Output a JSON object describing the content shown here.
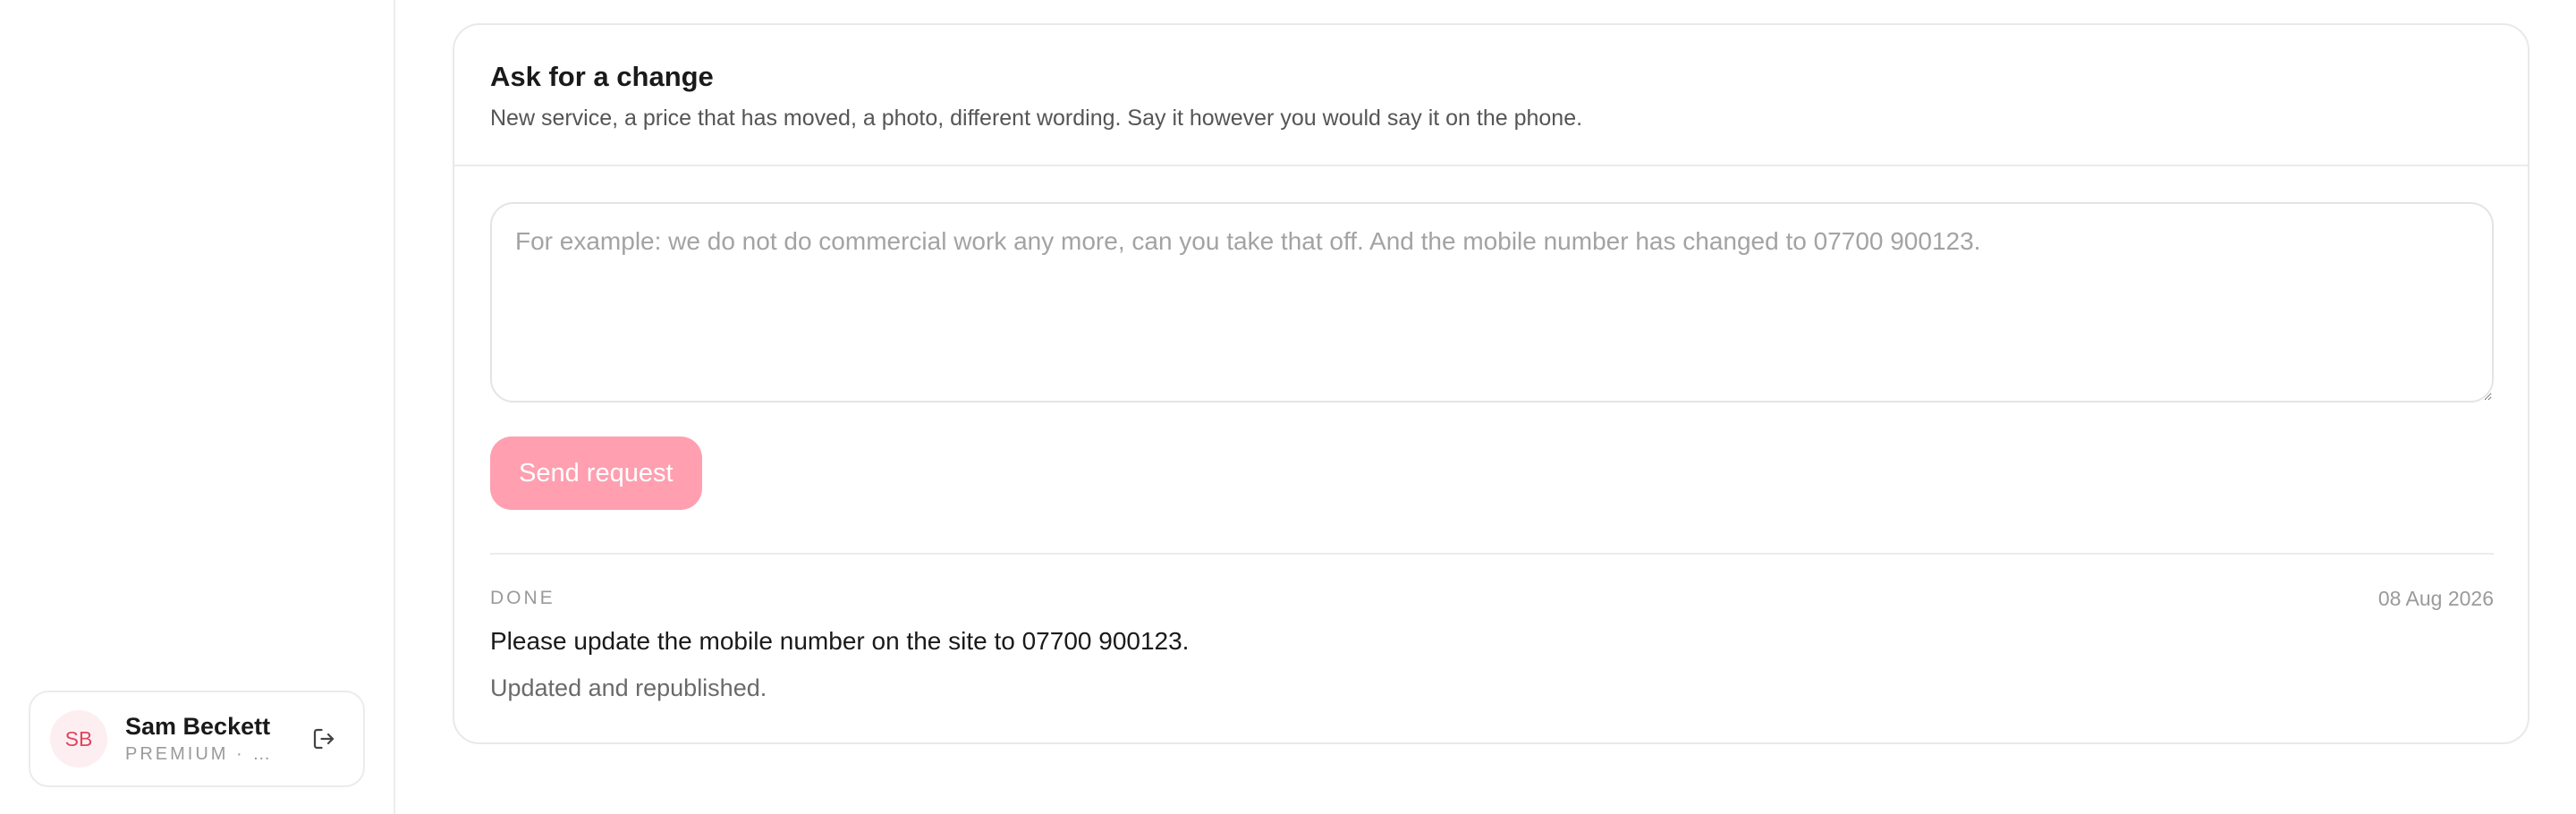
{
  "sidebar": {
    "user": {
      "initials": "SB",
      "name": "Sam Beckett",
      "plan": "PREMIUM · S…",
      "logout_icon": "logout-icon"
    }
  },
  "change_request": {
    "title": "Ask for a change",
    "subtitle": "New service, a price that has moved, a photo, different wording. Say it however you would say it on the phone.",
    "textarea": {
      "value": "",
      "placeholder": "For example: we do not do commercial work any more, can you take that off. And the mobile number has changed to 07700 900123."
    },
    "send_label": "Send request",
    "history": [
      {
        "status": "DONE",
        "date": "08 Aug 2026",
        "request": "Please update the mobile number on the site to 07700 900123.",
        "response": "Updated and republished."
      }
    ]
  },
  "colors": {
    "accent": "#ff9fb0",
    "avatar_bg": "#fdeef1",
    "avatar_text": "#e0445f"
  }
}
